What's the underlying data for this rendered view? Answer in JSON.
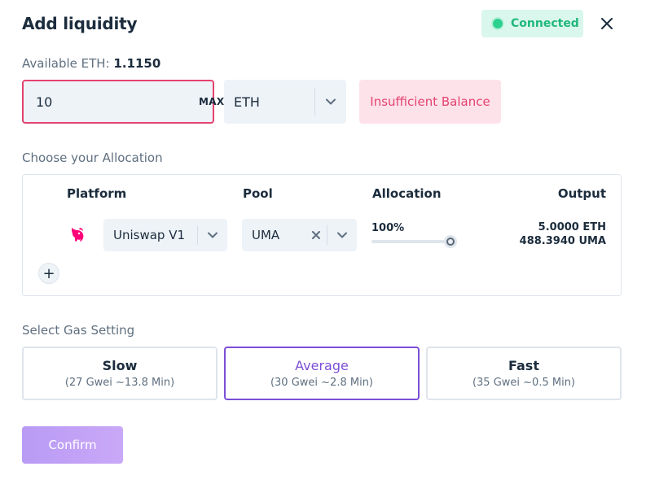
{
  "dialog": {
    "title": "Add liquidity",
    "status": "Connected",
    "close_icon": "close-icon"
  },
  "balance": {
    "label": "Available ETH:",
    "value": "1.1150"
  },
  "amount": {
    "value": "10",
    "max_label": "MAX"
  },
  "token": {
    "selected": "ETH"
  },
  "warning": "Insufficient Balance",
  "allocation": {
    "section_label": "Choose your Allocation",
    "headers": {
      "platform": "Platform",
      "pool": "Pool",
      "allocation": "Allocation",
      "output": "Output"
    },
    "rows": [
      {
        "platform_icon": "uniswap-unicorn-icon",
        "platform": "Uniswap V1",
        "pool": "UMA",
        "allocation_pct": "100%",
        "allocation_fraction": 1.0,
        "output_eth": "5.0000 ETH",
        "output_token": "488.3940 UMA"
      }
    ],
    "add_label": "+"
  },
  "gas": {
    "section_label": "Select Gas Setting",
    "options": [
      {
        "name": "Slow",
        "detail": "(27 Gwei ~13.8 Min)",
        "selected": false
      },
      {
        "name": "Average",
        "detail": "(30 Gwei ~2.8 Min)",
        "selected": true
      },
      {
        "name": "Fast",
        "detail": "(35 Gwei ~0.5 Min)",
        "selected": false
      }
    ]
  },
  "confirm_label": "Confirm",
  "colors": {
    "accent": "#7b4fd6",
    "error": "#e5426f",
    "success": "#2bd18f",
    "uniswap": "#ff007a"
  }
}
